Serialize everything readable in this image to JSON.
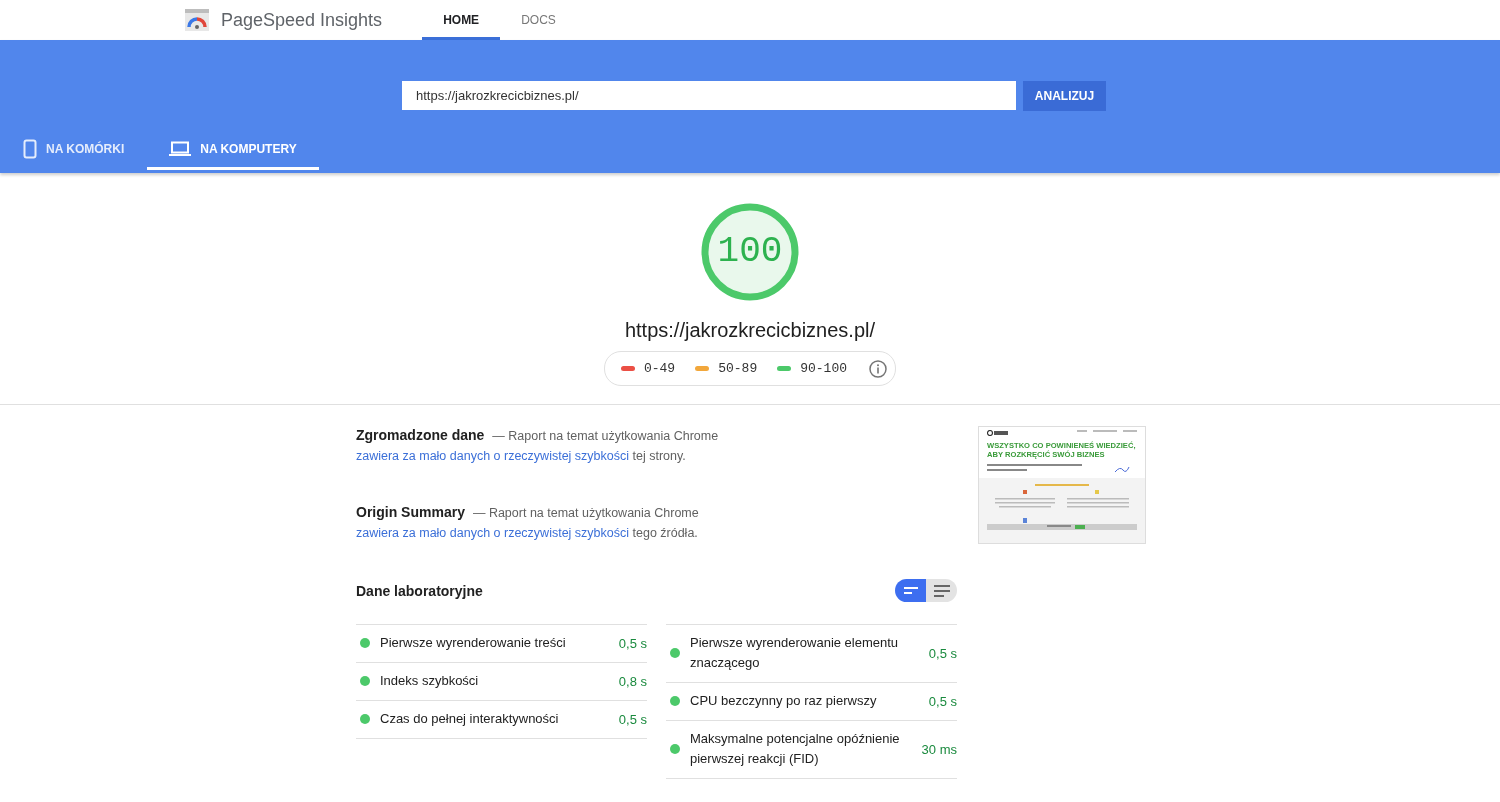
{
  "app": {
    "title": "PageSpeed Insights"
  },
  "nav_tabs": [
    {
      "label": "HOME",
      "selected": true
    },
    {
      "label": "DOCS",
      "selected": false
    }
  ],
  "url_field": {
    "value": "https://jakrozkrecicbiznes.pl/"
  },
  "analyze_button": "ANALIZUJ",
  "device_tabs": [
    {
      "label": "NA KOMÓRKI",
      "kind": "phone",
      "selected": false
    },
    {
      "label": "NA KOMPUTERY",
      "kind": "laptop",
      "selected": true
    }
  ],
  "score": {
    "value": "100",
    "level": 1
  },
  "tested_url": "https://jakrozkrecicbiznes.pl/",
  "legend": [
    {
      "label": "0-49",
      "color": "#eb4f45"
    },
    {
      "label": "50-89",
      "color": "#f2a73b"
    },
    {
      "label": "90-100",
      "color": "#4cc96a"
    }
  ],
  "sections": [
    {
      "title": "Zgromadzone dane",
      "text": "— Raport na temat użytkowania Chrome",
      "link": "zawiera za mało danych o rzeczywistej szybkości",
      "suffix": "tej strony."
    },
    {
      "title": "Origin Summary",
      "text": "— Raport na temat użytkowania Chrome",
      "link": "zawiera za mało danych o rzeczywistej szybkości",
      "suffix": "tego źródła."
    }
  ],
  "thumbnail": {
    "headline": "WSZYSTKO CO POWINIENEŚ WIEDZIEĆ, ABY ROZKRĘCIĆ SWÓJ BIZNES"
  },
  "lab": {
    "title": "Dane laboratoryjne",
    "view_toggle": [
      {
        "kind": "compact",
        "selected": true
      },
      {
        "kind": "expanded",
        "selected": false
      }
    ],
    "columns": [
      [
        {
          "label": "Pierwsze wyrenderowanie treści",
          "value": "0,5 s"
        },
        {
          "label": "Indeks szybkości",
          "value": "0,8 s"
        },
        {
          "label": "Czas do pełnej interaktywności",
          "value": "0,5 s"
        }
      ],
      [
        {
          "label": "Pierwsze wyrenderowanie elementu znaczącego",
          "value": "0,5 s"
        },
        {
          "label": "CPU bezczynny po raz pierwszy",
          "value": "0,5 s"
        },
        {
          "label": "Maksymalne potencjalne opóźnienie pierwszej reakcji (FID)",
          "value": "30 ms"
        }
      ]
    ]
  }
}
